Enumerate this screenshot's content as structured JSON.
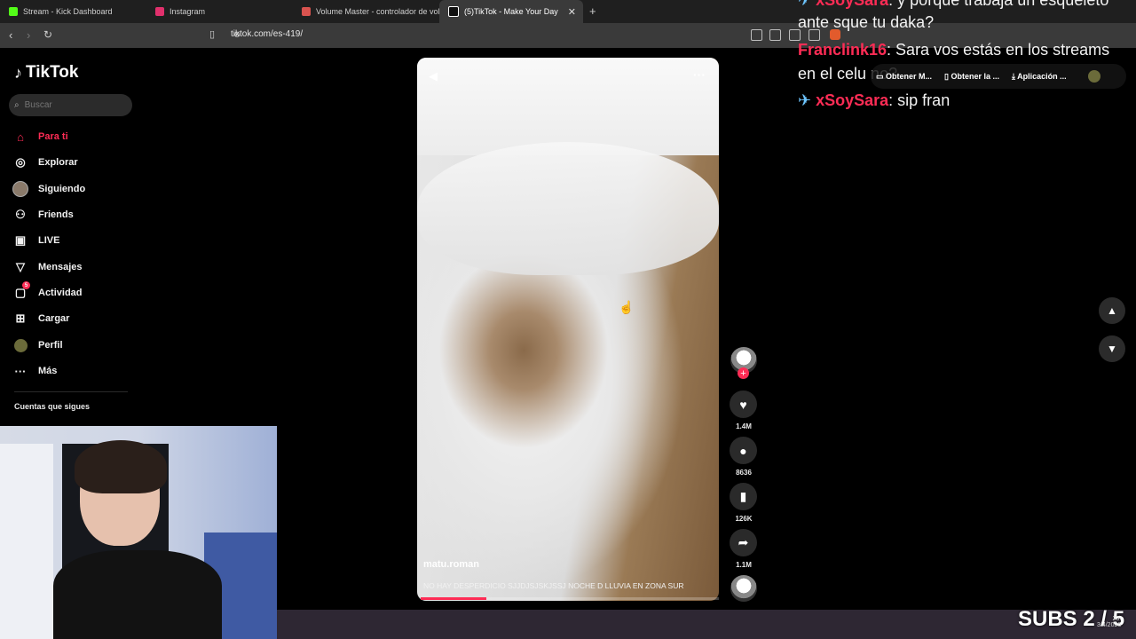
{
  "browser": {
    "tabs": [
      {
        "title": "Stream - Kick Dashboard",
        "color": "#53fc18"
      },
      {
        "title": "Instagram",
        "color": "#e1306c"
      },
      {
        "title": "Volume Master - controlador de volu",
        "color": "#d9534f"
      },
      {
        "title": "(5)TikTok - Make Your Day",
        "color": "#111111"
      }
    ],
    "url": "tiktok.com/es-419/"
  },
  "sidebar": {
    "logo": "TikTok",
    "search_placeholder": "Buscar",
    "items": [
      {
        "label": "Para ti",
        "icon": "home-icon"
      },
      {
        "label": "Explorar",
        "icon": "compass-icon"
      },
      {
        "label": "Siguiendo",
        "icon": "avatar-icon"
      },
      {
        "label": "Friends",
        "icon": "friends-icon"
      },
      {
        "label": "LIVE",
        "icon": "live-icon"
      },
      {
        "label": "Mensajes",
        "icon": "send-icon"
      },
      {
        "label": "Actividad",
        "icon": "inbox-icon",
        "badge": "5"
      },
      {
        "label": "Cargar",
        "icon": "upload-icon"
      },
      {
        "label": "Perfil",
        "icon": "profile-icon"
      },
      {
        "label": "Más",
        "icon": "more-icon"
      }
    ],
    "following_header": "Cuentas que sigues"
  },
  "video": {
    "author": "matu.roman",
    "caption": "NO HAY DESPERDICIO SJJDJSJSKJSSJ NOCHE D LLUVIA EN ZONA SUR",
    "progress": 0.22,
    "counts": {
      "likes": "1.4M",
      "comments": "8636",
      "saves": "126K",
      "shares": "1.1M"
    }
  },
  "chat": [
    {
      "user": "xSoySara",
      "text": ": y porque trabaja un esqueleto"
    },
    {
      "user": "",
      "text": "ante sque tu daka?"
    },
    {
      "user": "Franclink16",
      "text": ": Sara vos estás en los streams"
    },
    {
      "user": "",
      "text": "en el celu no?"
    },
    {
      "user": "xSoySara",
      "text": ": sip fran"
    }
  ],
  "get_bar": [
    "Obtener M...",
    "Obtener la ...",
    "Aplicación ..."
  ],
  "overlay": {
    "subs": "SUBS 2 / 5",
    "time": "23:",
    "date": "3/4/2026"
  },
  "colors": {
    "accent": "#fe2c55",
    "chat_user": "#ff6f96"
  }
}
